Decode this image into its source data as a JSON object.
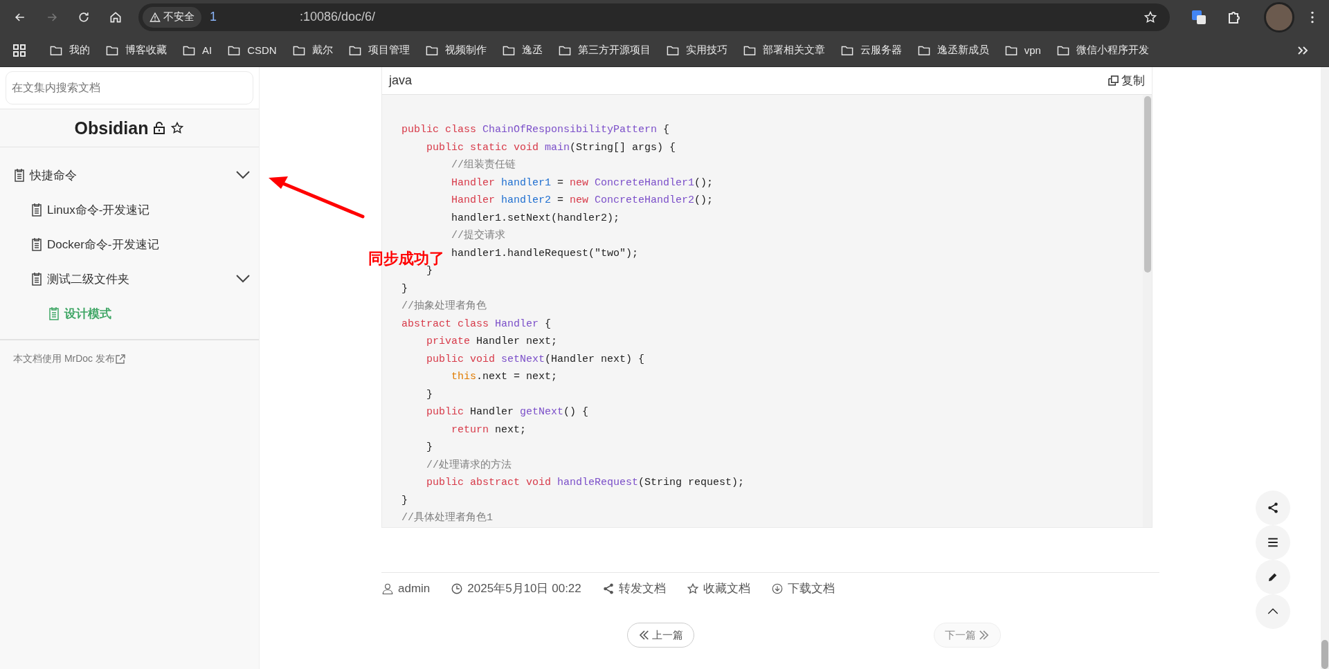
{
  "browser": {
    "nav": [
      {
        "kind": "back",
        "disabled": false
      },
      {
        "kind": "forward",
        "disabled": true
      },
      {
        "kind": "reload",
        "disabled": false
      },
      {
        "kind": "home",
        "disabled": false
      }
    ],
    "security_badge": "不安全",
    "url_host": "1",
    "url_path": ":10086/doc/6/",
    "bookmarks": [
      "我的",
      "博客收藏",
      "AI",
      "CSDN",
      "戴尔",
      "项目管理",
      "视频制作",
      "逸丞",
      "第三方开源项目",
      "实用技巧",
      "部署相关文章",
      "云服务器",
      "逸丞新成员",
      "vpn",
      "微信小程序开发"
    ]
  },
  "sidebar": {
    "search": {
      "placeholder": "在文集内搜索文档"
    },
    "title": "Obsidian",
    "tree": [
      {
        "label": "快捷命令",
        "expanded": true,
        "selected": false,
        "children": [
          {
            "label": "Linux命令-开发速记",
            "selected": false
          },
          {
            "label": "Docker命令-开发速记",
            "selected": false
          },
          {
            "label": "测试二级文件夹",
            "expanded": true,
            "selected": false,
            "children": [
              {
                "label": "设计模式",
                "selected": true
              }
            ]
          }
        ]
      }
    ],
    "footer": "本文档使用 MrDoc 发布"
  },
  "code_block": {
    "language": "java",
    "copy_label": "复制",
    "lines": [
      [
        {
          "kind": "k",
          "text": "public class "
        },
        {
          "kind": "t",
          "text": "ChainOfResponsibilityPattern"
        },
        {
          "kind": "p",
          "text": " {"
        }
      ],
      [
        {
          "kind": "k",
          "text": "    public static void "
        },
        {
          "kind": "t",
          "text": "main"
        },
        {
          "kind": "p",
          "text": "(String[] args) {"
        }
      ],
      [
        {
          "kind": "c",
          "text": "        //组装责任链"
        }
      ],
      [
        {
          "kind": "k",
          "text": "        Handler "
        },
        {
          "kind": "v",
          "text": "handler1"
        },
        {
          "kind": "p",
          "text": " = "
        },
        {
          "kind": "k",
          "text": "new "
        },
        {
          "kind": "t",
          "text": "ConcreteHandler1"
        },
        {
          "kind": "p",
          "text": "();"
        }
      ],
      [
        {
          "kind": "k",
          "text": "        Handler "
        },
        {
          "kind": "v",
          "text": "handler2"
        },
        {
          "kind": "p",
          "text": " = "
        },
        {
          "kind": "k",
          "text": "new "
        },
        {
          "kind": "t",
          "text": "ConcreteHandler2"
        },
        {
          "kind": "p",
          "text": "();"
        }
      ],
      [
        {
          "kind": "p",
          "text": "        handler1.setNext(handler2);"
        }
      ],
      [
        {
          "kind": "c",
          "text": "        //提交请求"
        }
      ],
      [
        {
          "kind": "p",
          "text": "        handler1.handleRequest(\"two\");"
        }
      ],
      [
        {
          "kind": "p",
          "text": "    }"
        }
      ],
      [
        {
          "kind": "p",
          "text": "}"
        }
      ],
      [
        {
          "kind": "c",
          "text": "//抽象处理者角色"
        }
      ],
      [
        {
          "kind": "k",
          "text": "abstract class "
        },
        {
          "kind": "t",
          "text": "Handler"
        },
        {
          "kind": "p",
          "text": " {"
        }
      ],
      [
        {
          "kind": "k",
          "text": "    private "
        },
        {
          "kind": "p",
          "text": "Handler next;"
        }
      ],
      [
        {
          "kind": "k",
          "text": "    public void "
        },
        {
          "kind": "t",
          "text": "setNext"
        },
        {
          "kind": "p",
          "text": "(Handler next) {"
        }
      ],
      [
        {
          "kind": "o",
          "text": "        this"
        },
        {
          "kind": "p",
          "text": ".next = next;"
        }
      ],
      [
        {
          "kind": "p",
          "text": "    }"
        }
      ],
      [
        {
          "kind": "k",
          "text": "    public "
        },
        {
          "kind": "p",
          "text": "Handler "
        },
        {
          "kind": "t",
          "text": "getNext"
        },
        {
          "kind": "p",
          "text": "() {"
        }
      ],
      [
        {
          "kind": "k",
          "text": "        return "
        },
        {
          "kind": "p",
          "text": "next;"
        }
      ],
      [
        {
          "kind": "p",
          "text": "    }"
        }
      ],
      [
        {
          "kind": "c",
          "text": "    //处理请求的方法"
        }
      ],
      [
        {
          "kind": "k",
          "text": "    public abstract void "
        },
        {
          "kind": "t",
          "text": "handleRequest"
        },
        {
          "kind": "p",
          "text": "(String request);"
        }
      ],
      [
        {
          "kind": "p",
          "text": "}"
        }
      ],
      [
        {
          "kind": "c",
          "text": "//具体处理者角色1"
        }
      ]
    ]
  },
  "annotation": {
    "text": "同步成功了"
  },
  "meta": [
    {
      "kind": "user",
      "text": "admin"
    },
    {
      "kind": "time",
      "text": "2025年5月10日 00:22"
    },
    {
      "kind": "share",
      "text": "转发文档"
    },
    {
      "kind": "star",
      "text": "收藏文档"
    },
    {
      "kind": "download",
      "text": "下载文档"
    }
  ],
  "pager": [
    {
      "kind": "prev",
      "label": "上一篇",
      "disabled": false
    },
    {
      "kind": "next",
      "label": "下一篇",
      "disabled": true
    }
  ],
  "float_buttons": [
    {
      "kind": "share"
    },
    {
      "kind": "menu"
    },
    {
      "kind": "edit"
    },
    {
      "kind": "top"
    }
  ]
}
